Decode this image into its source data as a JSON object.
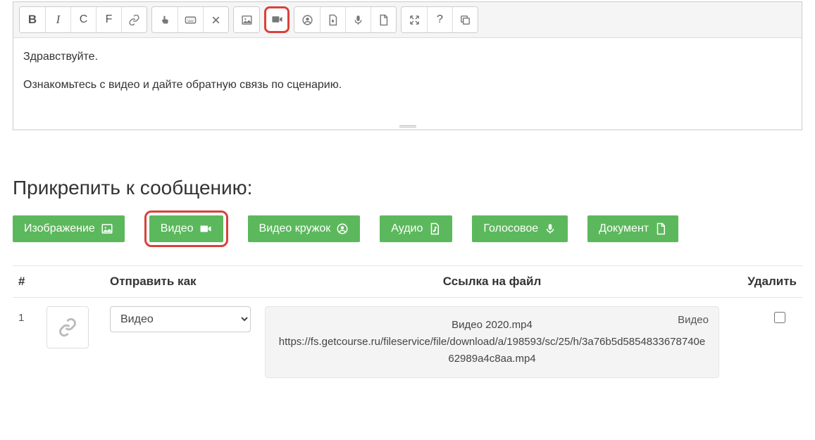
{
  "editor": {
    "line1": "Здравствуйте.",
    "line2": "Ознакомьтесь с видео и дайте обратную связь по сценарию."
  },
  "toolbar": {
    "bold": "B",
    "italic": "I",
    "c": "С",
    "f": "F",
    "question": "?"
  },
  "attach": {
    "title": "Прикрепить к сообщению:",
    "image": "Изображение",
    "video": "Видео",
    "video_circle": "Видео кружок",
    "audio": "Аудио",
    "voice": "Голосовое",
    "document": "Документ"
  },
  "table": {
    "col_num": "#",
    "col_sendas": "Отправить как",
    "col_file": "Ссылка на файл",
    "col_del": "Удалить",
    "rows": [
      {
        "num": "1",
        "send_as": "Видео",
        "badge": "Видео",
        "file_name": "Видео 2020.mp4",
        "file_url": "https://fs.getcourse.ru/fileservice/file/download/a/198593/sc/25/h/3a76b5d5854833678740e62989a4c8aa.mp4"
      }
    ]
  }
}
